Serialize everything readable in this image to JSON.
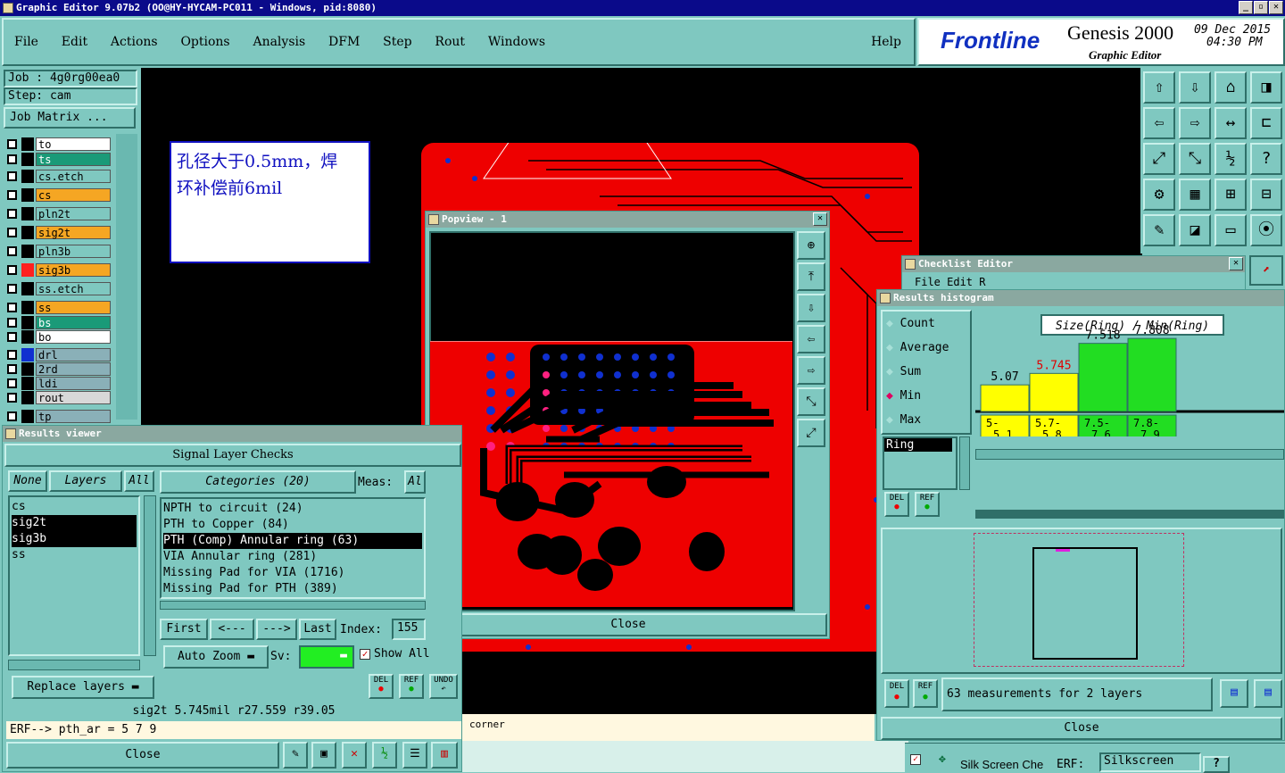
{
  "app_title": "Graphic Editor 9.07b2  (OO@HY-HYCAM-PC011 - Windows, pid:8080)",
  "menu": [
    "File",
    "Edit",
    "Actions",
    "Options",
    "Analysis",
    "DFM",
    "Step",
    "Rout",
    "Windows"
  ],
  "help": "Help",
  "brand": {
    "logo": "Frontline",
    "product": "Genesis 2000",
    "subtitle": "Graphic Editor",
    "date": "09 Dec 2015",
    "time": "04:30 PM"
  },
  "job": {
    "job_label": "Job : 4g0rg00ea0",
    "step_label": "Step: cam",
    "matrix_button": "Job Matrix ..."
  },
  "layers": [
    {
      "name": "to",
      "color": "#ffffff",
      "swatch": "#000000"
    },
    {
      "name": "ts",
      "color": "#1a9a78",
      "swatch": "#000000"
    },
    {
      "name": "cs.etch",
      "color": "#7fc8c0",
      "swatch": "#000000"
    },
    {
      "name": "cs",
      "color": "#f5a623",
      "swatch": "#000000"
    },
    {
      "name": "pln2t",
      "color": "#7fc8c0",
      "swatch": "#000000"
    },
    {
      "name": "sig2t",
      "color": "#f5a623",
      "swatch": "#000000"
    },
    {
      "name": "pln3b",
      "color": "#7fc8c0",
      "swatch": "#000000"
    },
    {
      "name": "sig3b",
      "color": "#f5a623",
      "swatch": "#ff2020"
    },
    {
      "name": "ss.etch",
      "color": "#7fc8c0",
      "swatch": "#000000"
    },
    {
      "name": "ss",
      "color": "#f5a623",
      "swatch": "#000000"
    },
    {
      "name": "bs",
      "color": "#1a9a78",
      "swatch": "#000000"
    },
    {
      "name": "bo",
      "color": "#ffffff",
      "swatch": "#000000"
    },
    {
      "name": "drl",
      "color": "#8ab0b8",
      "swatch": "#1030d0"
    },
    {
      "name": "2rd",
      "color": "#8ab0b8",
      "swatch": "#000000"
    },
    {
      "name": "ldi",
      "color": "#8ab0b8",
      "swatch": "#000000"
    },
    {
      "name": "rout",
      "color": "#d8d8d8",
      "swatch": "#000000"
    },
    {
      "name": "tp",
      "color": "#8ab0b8",
      "swatch": "#000000"
    }
  ],
  "note": {
    "line1": "孔径大于0.5mm，焊",
    "line2": "环补偿前6mil"
  },
  "popview": {
    "title": "Popview - 1",
    "close": "Close"
  },
  "results_viewer": {
    "title": "Results viewer",
    "header": "Signal Layer Checks",
    "none_btn": "None",
    "layers_btn": "Layers",
    "all_btn": "All",
    "layer_list": [
      "cs",
      "sig2t",
      "sig3b",
      "ss"
    ],
    "categories_btn": "Categories (20)",
    "meas_label": "Meas:",
    "meas_all": "Al",
    "categories": [
      "NPTH to circuit (24)",
      "PTH to Copper (84)",
      "PTH (Comp) Annular ring (63)",
      "VIA Annular ring (281)",
      "Missing Pad for VIA (1716)",
      "Missing Pad for PTH (389)"
    ],
    "first": "First",
    "prev": "<---",
    "next": "--->",
    "last": "Last",
    "index_label": "Index:",
    "index_value": "155",
    "auto_zoom": "Auto Zoom",
    "sv_label": "Sv:",
    "show_all": "Show All",
    "replace_layers": "Replace layers",
    "status": "sig2t 5.745mil  r27.559  r39.05",
    "erf": "ERF--> pth_ar = 5 7 9",
    "close": "Close",
    "del": "DEL",
    "ref": "REF",
    "undo": "UNDO"
  },
  "corner_text": "corner",
  "checklist_editor": {
    "title": "Checklist Editor",
    "menu": "File Edit R"
  },
  "histogram": {
    "title": "Results histogram",
    "modes": [
      "Count",
      "Average",
      "Sum",
      "Min",
      "Max"
    ],
    "selected_mode": "Min",
    "chart_title": "Size(Ring) / Min(Ring)",
    "ring_label": "Ring",
    "summary": "63 measurements for 2 layers",
    "close": "Close",
    "del": "DEL",
    "ref": "REF"
  },
  "bottom_bar": {
    "silk": "Silk Screen Che",
    "erf": "ERF:",
    "silk_value": "Silkscreen",
    "help": "?"
  },
  "chart_data": {
    "type": "bar",
    "title": "Size(Ring) / Min(Ring)",
    "categories": [
      "5-5.1",
      "5.7-5.8",
      "7.5-7.6",
      "7.8-7.9"
    ],
    "values": [
      5.07,
      5.745,
      7.518,
      7.808
    ],
    "labels": [
      "5.07",
      "5.745",
      "7.518",
      "7.808"
    ],
    "colors": [
      "#ffff00",
      "#ffff00",
      "#22dd22",
      "#22dd22"
    ],
    "label_colors": [
      "#000000",
      "#e00000",
      "#000000",
      "#000000"
    ]
  }
}
